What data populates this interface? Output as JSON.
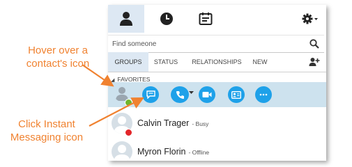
{
  "callouts": {
    "hover": "Hover over a contact's icon",
    "click": "Click Instant Messaging icon"
  },
  "colors": {
    "callout": "#f08230",
    "accent": "#1ea1e9",
    "row_highlight": "#cde2ee",
    "available": "#6fb52c",
    "busy": "#e3262a"
  },
  "top_tabs": [
    {
      "icon": "person-icon",
      "active": true
    },
    {
      "icon": "clock-icon",
      "active": false
    },
    {
      "icon": "dialpad-icon",
      "active": false
    }
  ],
  "settings": {
    "icon": "gear-icon"
  },
  "search": {
    "placeholder": "Find someone",
    "icon": "search-icon"
  },
  "filter_tabs": [
    {
      "label": "GROUPS",
      "active": true
    },
    {
      "label": "STATUS",
      "active": false
    },
    {
      "label": "RELATIONSHIPS",
      "active": false
    },
    {
      "label": "NEW",
      "active": false
    }
  ],
  "add_contact": {
    "icon": "add-contact-icon"
  },
  "group": {
    "label": "FAVORITES"
  },
  "hover_actions": [
    {
      "name": "instant-message",
      "icon": "chat-bubble-icon"
    },
    {
      "name": "call",
      "icon": "phone-icon"
    },
    {
      "name": "video",
      "icon": "video-camera-icon"
    },
    {
      "name": "contact-card",
      "icon": "contact-card-icon"
    },
    {
      "name": "more",
      "icon": "more-options-icon"
    }
  ],
  "contacts": [
    {
      "name": "Calvin Trager",
      "status": "- Busy"
    },
    {
      "name": "Myron Florin",
      "status": "- Offline"
    }
  ]
}
